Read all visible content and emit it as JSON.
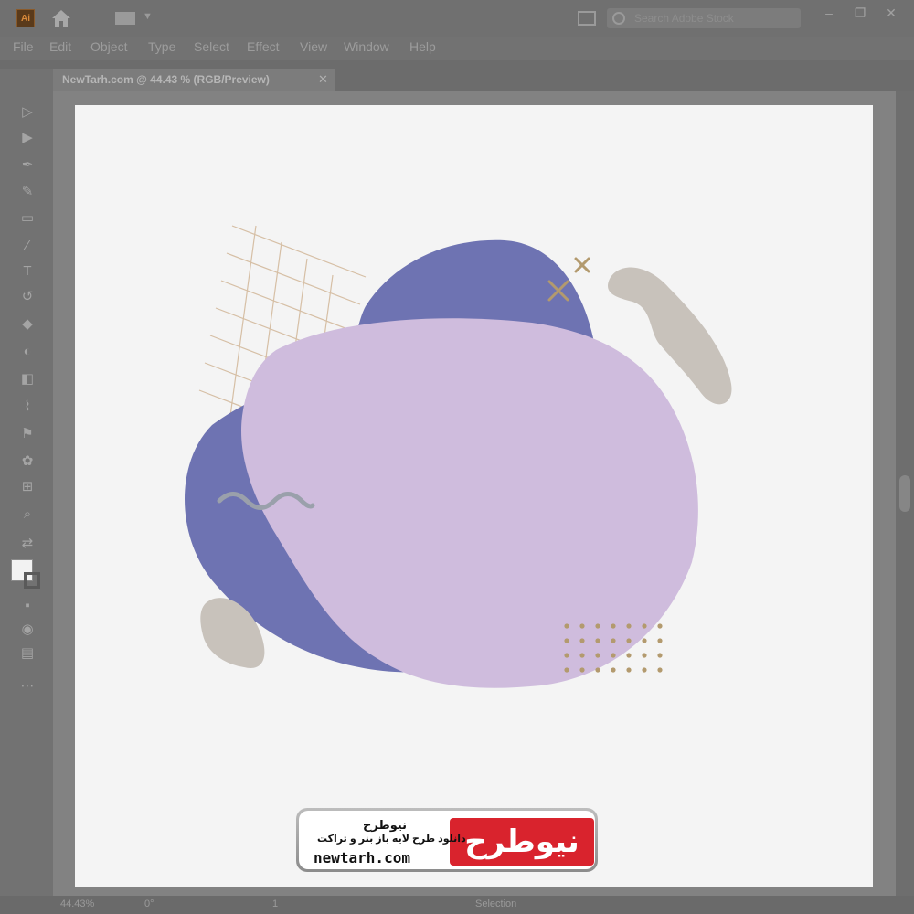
{
  "app": {
    "logo_text": "Ai"
  },
  "search": {
    "placeholder": "Search Adobe Stock"
  },
  "window_controls": {
    "minimize": "–",
    "restore": "❐",
    "close": "✕"
  },
  "menu": [
    "File",
    "Edit",
    "Object",
    "Type",
    "Select",
    "Effect",
    "View",
    "Window",
    "Help"
  ],
  "document": {
    "tab_label": "NewTarh.com @ 44.43 % (RGB/Preview)",
    "close": "✕"
  },
  "status": {
    "zoom": "44.43%",
    "rotation": "0°",
    "artboard": "1",
    "tool": "Selection"
  },
  "banner": {
    "logo_word": "نیوطرح",
    "title": "نیوطرح",
    "subtitle": "دانلود طرح لایه باز بنر و تراکت",
    "url": "newtarh.com"
  },
  "colors": {
    "blob_blue": "#6e73b2",
    "blob_lavender": "#cfbcdd",
    "blob_taupe": "#c8c2bb",
    "accent_gold": "#b39a6e",
    "wave_gray": "#9aa0ab",
    "artboard": "#f4f4f4",
    "brand_red": "#d9232d"
  },
  "icons": [
    "direct-select-icon",
    "selection-icon",
    "pen-icon",
    "curvature-icon",
    "rectangle-icon",
    "brush-icon",
    "type-icon",
    "rotate-icon",
    "eraser-icon",
    "width-icon",
    "shape-builder-icon",
    "eyedropper-icon",
    "blend-icon",
    "symbol-icon",
    "artboard-icon",
    "zoom-icon"
  ]
}
